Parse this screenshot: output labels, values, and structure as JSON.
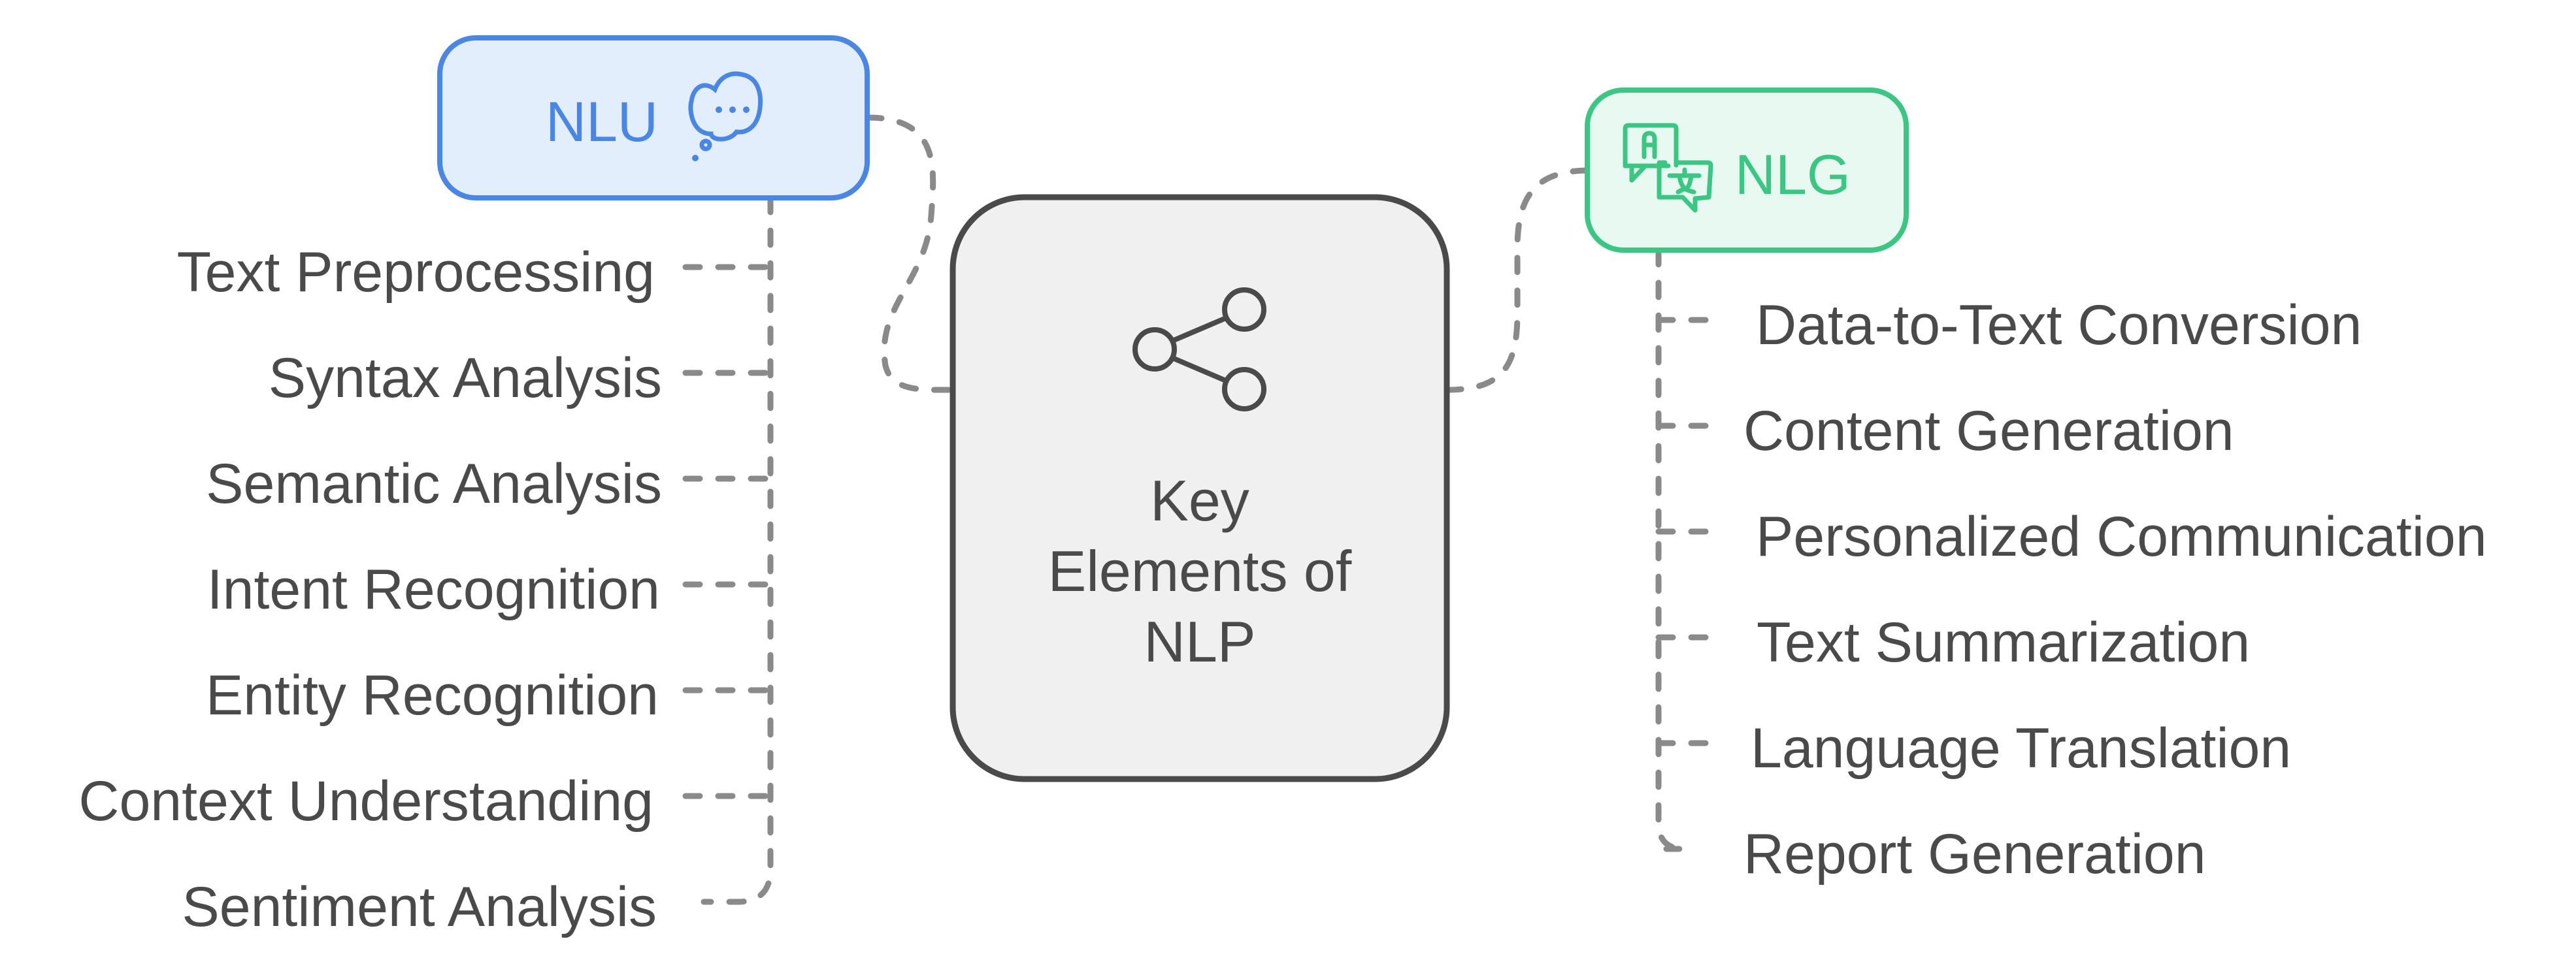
{
  "diagram": {
    "type": "mind-map",
    "center": {
      "title_lines": [
        "Key",
        "Elements of",
        "NLP"
      ],
      "icon": "share-icon"
    },
    "branches": {
      "nlu": {
        "label": "NLU",
        "icon": "thought-bubble-icon",
        "color": "#4a86e3",
        "fill": "#e3eefd",
        "items": [
          "Text Preprocessing",
          "Syntax Analysis",
          "Semantic Analysis",
          "Intent Recognition",
          "Entity Recognition",
          "Context Understanding",
          "Sentiment Analysis"
        ]
      },
      "nlg": {
        "label": "NLG",
        "icon": "translate-icon",
        "color": "#3cc684",
        "fill": "#e7f9f1",
        "items": [
          "Data-to-Text Conversion",
          "Content Generation",
          "Personalized Communication",
          "Text Summarization",
          "Language Translation",
          "Report Generation"
        ]
      }
    },
    "colors": {
      "text": "#4a4a4a",
      "center_border": "#4a4a4a",
      "center_fill": "#f0f0f0",
      "connector": "#8a8a8a"
    }
  }
}
